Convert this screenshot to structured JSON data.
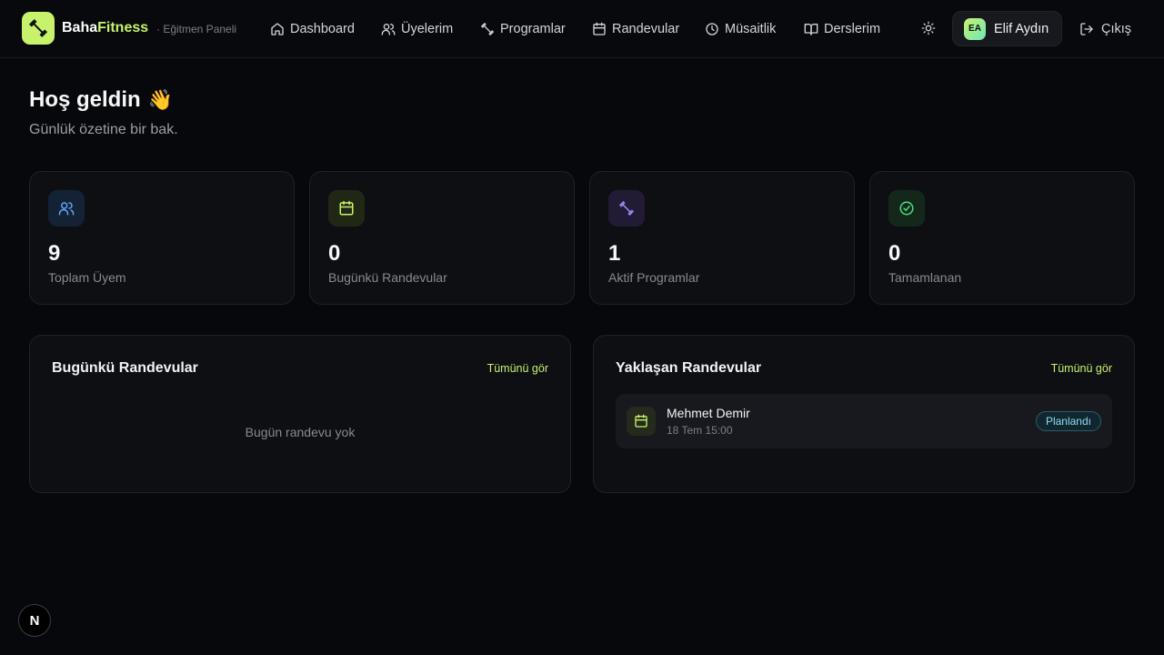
{
  "brand": {
    "name_part1": "Baha",
    "name_part2": "Fitness",
    "panel": "· Eğitmen Paneli"
  },
  "nav": [
    {
      "label": "Dashboard",
      "icon": "home-icon"
    },
    {
      "label": "Üyelerim",
      "icon": "users-icon"
    },
    {
      "label": "Programlar",
      "icon": "dumbbell-icon"
    },
    {
      "label": "Randevular",
      "icon": "calendar-icon"
    },
    {
      "label": "Müsaitlik",
      "icon": "clock-icon"
    },
    {
      "label": "Derslerim",
      "icon": "book-icon"
    }
  ],
  "user": {
    "initials": "EA",
    "name": "Elif Aydın"
  },
  "logout_label": "Çıkış",
  "welcome": {
    "title": "Hoş geldin",
    "emoji": "👋",
    "subtitle": "Günlük özetine bir bak."
  },
  "stats": [
    {
      "value": "9",
      "label": "Toplam Üyem",
      "icon": "users-icon",
      "color": "#60a5fa"
    },
    {
      "value": "0",
      "label": "Bugünkü Randevular",
      "icon": "calendar-icon",
      "color": "#c8f26c"
    },
    {
      "value": "1",
      "label": "Aktif Programlar",
      "icon": "dumbbell-icon",
      "color": "#a78bfa"
    },
    {
      "value": "0",
      "label": "Tamamlanan",
      "icon": "check-circle-icon",
      "color": "#4ade80"
    }
  ],
  "today_panel": {
    "title": "Bugünkü Randevular",
    "link": "Tümünü gör",
    "empty": "Bugün randevu yok"
  },
  "upcoming_panel": {
    "title": "Yaklaşan Randevular",
    "link": "Tümünü gör",
    "items": [
      {
        "name": "Mehmet Demir",
        "time": "18 Tem 15:00",
        "status": "Planlandı"
      }
    ]
  },
  "colors": {
    "accent": "#c8f26c",
    "background": "#07080b",
    "card": "#0d0f13"
  },
  "dev_badge": "N"
}
